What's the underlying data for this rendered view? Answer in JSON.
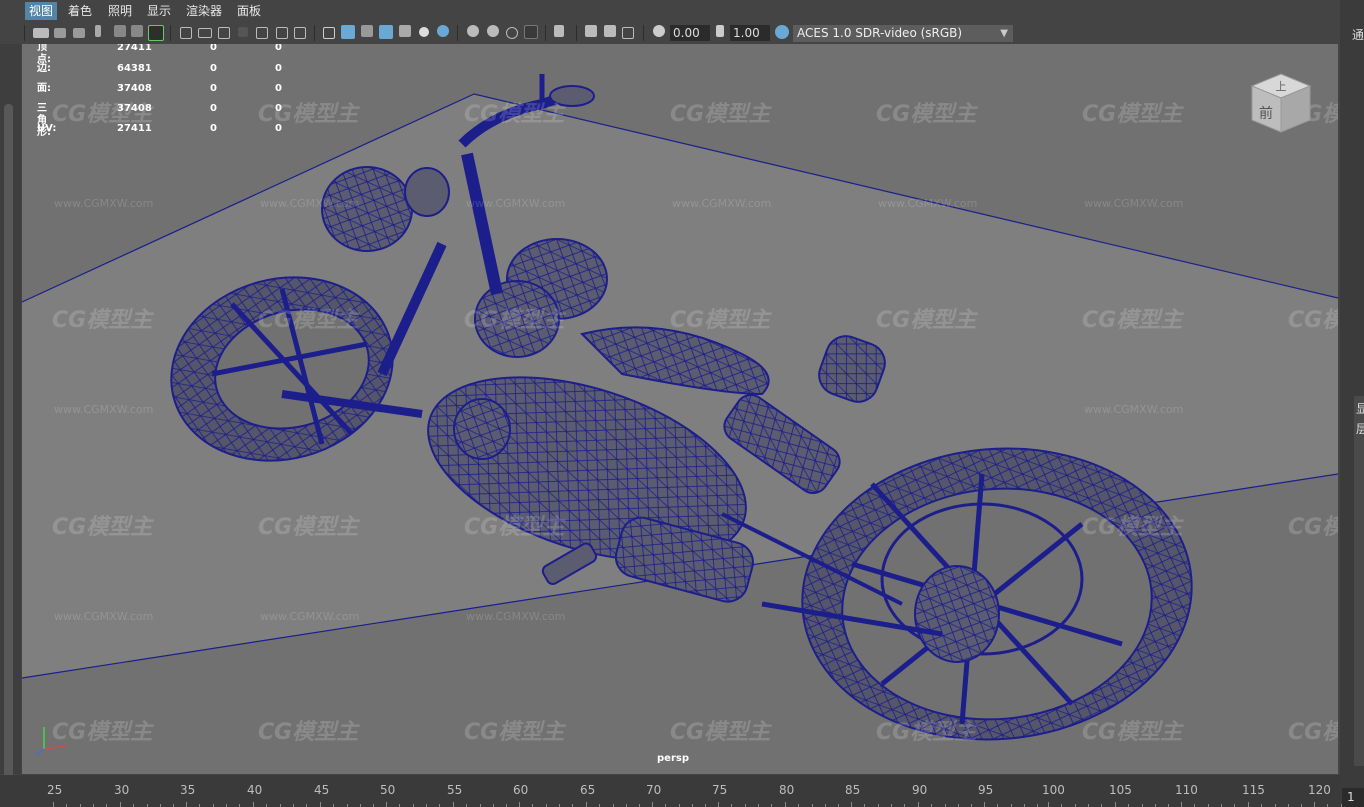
{
  "menu": [
    {
      "label": "视图",
      "active": true
    },
    {
      "label": "着色",
      "active": false
    },
    {
      "label": "照明",
      "active": false
    },
    {
      "label": "显示",
      "active": false
    },
    {
      "label": "渲染器",
      "active": false
    },
    {
      "label": "面板",
      "active": false
    }
  ],
  "toolbar": {
    "exposure_value": "0.00",
    "gamma_value": "1.00",
    "color_space": "ACES 1.0 SDR-video (sRGB)"
  },
  "hud": {
    "rows": [
      {
        "label": "顶点:",
        "values": [
          "27411",
          "0",
          "0"
        ]
      },
      {
        "label": "边:",
        "values": [
          "64381",
          "0",
          "0"
        ]
      },
      {
        "label": "面:",
        "values": [
          "37408",
          "0",
          "0"
        ]
      },
      {
        "label": "三角形:",
        "values": [
          "37408",
          "0",
          "0"
        ]
      },
      {
        "label": "UV:",
        "values": [
          "27411",
          "0",
          "0"
        ]
      }
    ]
  },
  "viewcube": {
    "top_label": "上",
    "front_label": "前"
  },
  "camera_label": "persp",
  "watermark": {
    "logo": "CG模型主",
    "url": "www.CGMXW.com"
  },
  "right_panel": {
    "top_text": "通",
    "side_text_1": "显",
    "side_text_2": "层"
  },
  "timeline": {
    "ticks": [
      "25",
      "30",
      "35",
      "40",
      "45",
      "50",
      "55",
      "60",
      "65",
      "70",
      "75",
      "80",
      "85",
      "90",
      "95",
      "100",
      "105",
      "110",
      "115",
      "120"
    ],
    "current_frame": "1"
  },
  "colors": {
    "wire": "#1c1e8c",
    "mesh_fill": "#6a6a7a",
    "viewport_bg": "#717171",
    "ground": "#7f7f7f",
    "menu_active": "#5285a6"
  },
  "icons": [
    "camera-icon",
    "grid-icon",
    "wireframe-icon",
    "smooth-shade-icon",
    "textured-icon",
    "light-icon",
    "shadow-icon",
    "isolate-icon",
    "xray-icon",
    "colorspace-icon"
  ]
}
